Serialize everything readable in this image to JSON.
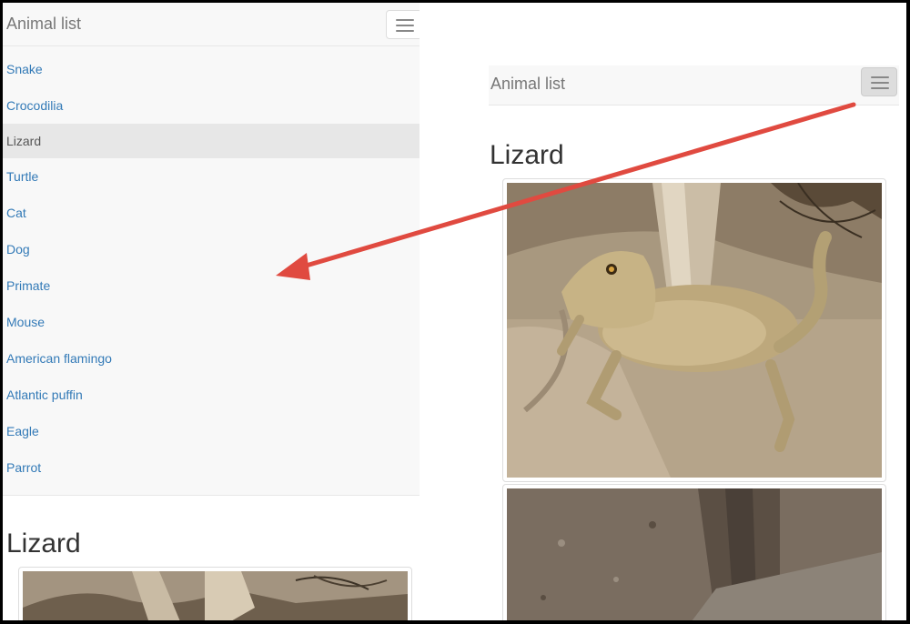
{
  "left": {
    "brand": "Animal list",
    "menu": [
      "Snake",
      "Crocodilia",
      "Lizard",
      "Turtle",
      "Cat",
      "Dog",
      "Primate",
      "Mouse",
      "American flamingo",
      "Atlantic puffin",
      "Eagle",
      "Parrot"
    ],
    "active_item": "Lizard",
    "heading": "Lizard"
  },
  "right": {
    "brand": "Animal list",
    "heading": "Lizard"
  },
  "colors": {
    "link": "#337ab7",
    "navbar_bg": "#f8f8f8",
    "arrow": "#e04a40"
  },
  "icons": [
    "hamburger-icon",
    "arrow-annotation"
  ]
}
